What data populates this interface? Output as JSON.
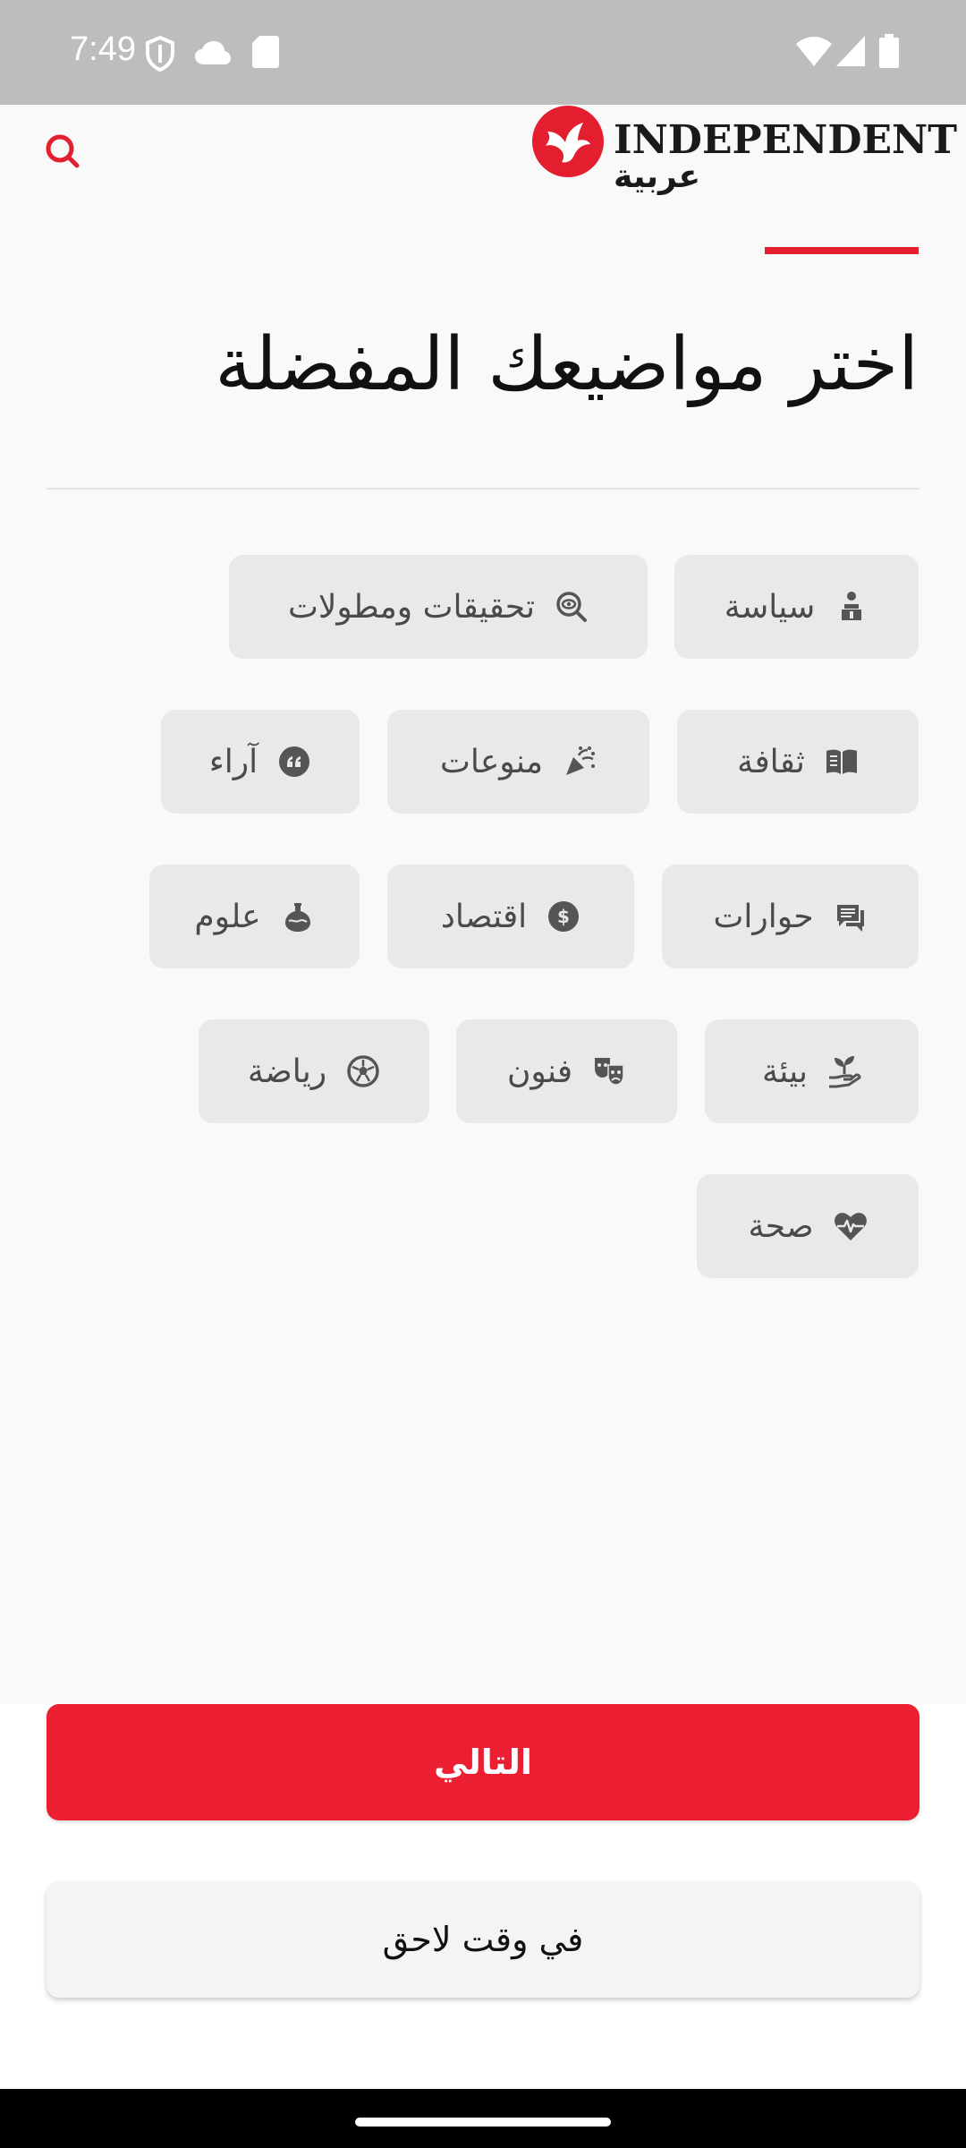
{
  "status_bar": {
    "time": "7:49",
    "icons": [
      "shield-icon",
      "cloud-icon",
      "sd-card-icon",
      "wifi-icon",
      "signal-icon",
      "battery-icon"
    ]
  },
  "header": {
    "logo_text": "INDEPENDENT",
    "logo_sub": "عربية",
    "search_icon": "search-icon"
  },
  "colors": {
    "accent": "#e31e2f",
    "chip_bg": "#e9e9e9",
    "button_primary": "#ec1e31"
  },
  "page": {
    "title": "اختر مواضيعك المفضلة"
  },
  "topics": [
    {
      "label": "سياسة",
      "icon": "podium-speaker-icon"
    },
    {
      "label": "تحقيقات ومطولات",
      "icon": "search-eye-icon"
    },
    {
      "label": "ثقافة",
      "icon": "open-book-icon"
    },
    {
      "label": "منوعات",
      "icon": "party-popper-icon"
    },
    {
      "label": "آراء",
      "icon": "quote-icon"
    },
    {
      "label": "حوارات",
      "icon": "chat-bubbles-icon"
    },
    {
      "label": "اقتصاد",
      "icon": "dollar-coin-icon"
    },
    {
      "label": "علوم",
      "icon": "flask-icon"
    },
    {
      "label": "بيئة",
      "icon": "hand-plant-icon"
    },
    {
      "label": "فنون",
      "icon": "theater-masks-icon"
    },
    {
      "label": "رياضة",
      "icon": "soccer-ball-icon"
    },
    {
      "label": "صحة",
      "icon": "heart-pulse-icon"
    }
  ],
  "actions": {
    "next_label": "التالي",
    "later_label": "في وقت لاحق"
  }
}
